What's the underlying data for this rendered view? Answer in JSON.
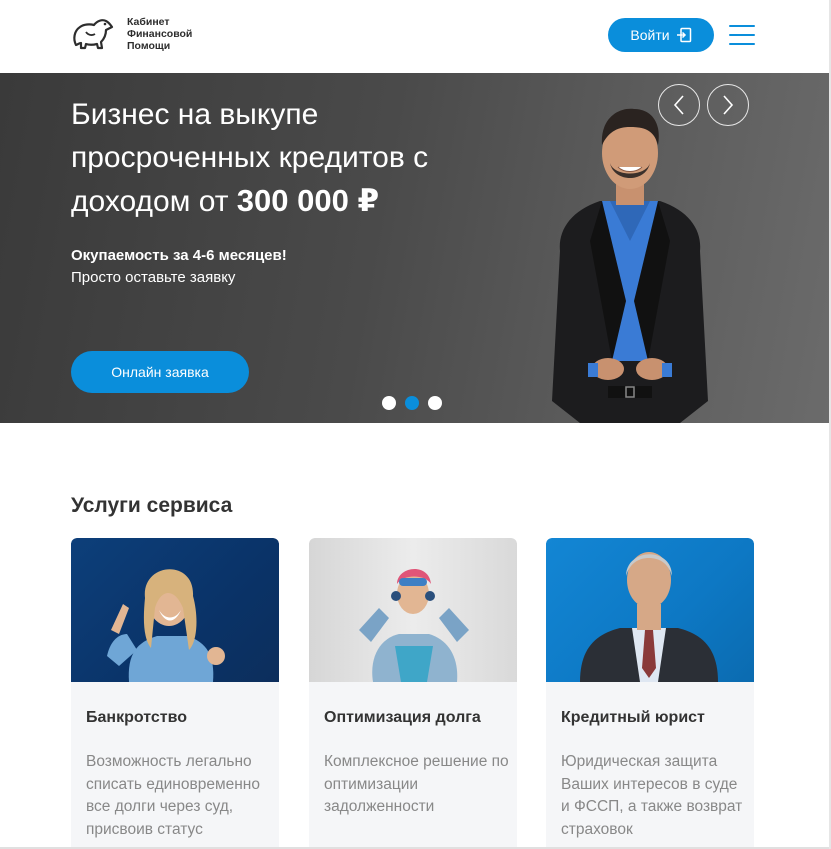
{
  "header": {
    "logo_lines": [
      "Кабинет",
      "Финансовой",
      "Помощи"
    ],
    "login_label": "Войти"
  },
  "hero": {
    "title_line1": "Бизнес на выкупе",
    "title_line2": "просроченных кредитов с",
    "title_line3_prefix": "доходом от ",
    "title_amount": "300 000 ₽",
    "subtitle_bold": "Окупаемость за 4-6 месяцев!",
    "subtitle": "Просто оставьте заявку",
    "cta_label": "Онлайн заявка",
    "slides_count": 3,
    "active_slide": 2
  },
  "services": {
    "title": "Услуги сервиса",
    "cards": [
      {
        "title": "Банкротство",
        "text": "Возможность легально списать единовременно все долги через суд, присвоив статус"
      },
      {
        "title": "Оптимизация долга",
        "text": "Комплексное решение по оптимизации задолженности"
      },
      {
        "title": "Кредитный юрист",
        "text": "Юридическая защита Ваших интересов в суде и ФССП, а также возврат страховок"
      }
    ]
  },
  "colors": {
    "accent": "#0a8edb",
    "hero_bg": "#4a4a4a",
    "card_bg": "#f5f6f8"
  }
}
